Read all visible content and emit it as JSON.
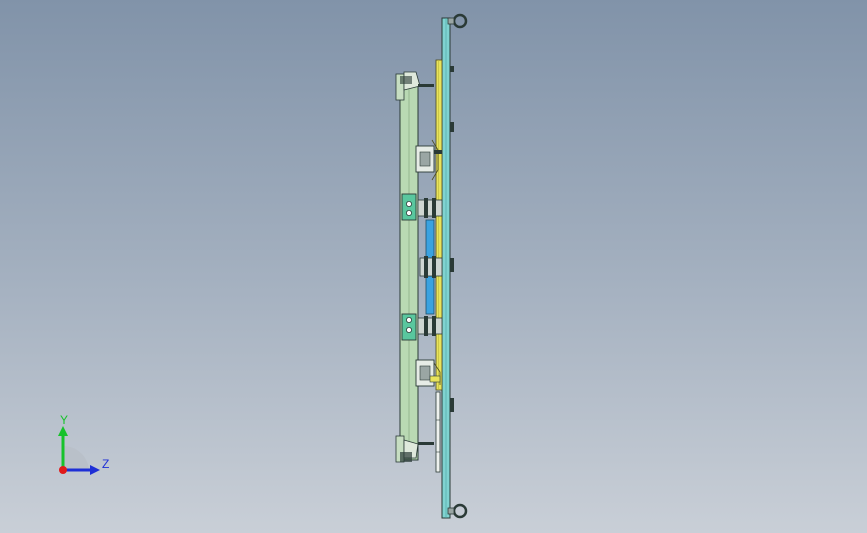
{
  "view": {
    "background_top": "#8193a9",
    "background_bottom": "#c9cfd7"
  },
  "colors": {
    "plate_teal": "#7fd3d1",
    "frame_green": "#b9d9b3",
    "rail_yellow": "#e8e35c",
    "blue_part": "#3aa2e0",
    "edge_dark": "#2a3a36"
  },
  "triad": {
    "y_label": "Y",
    "z_label": "Z",
    "y_color": "#17c22b",
    "z_color": "#1e2fd6",
    "x_color": "#e01a1a"
  }
}
